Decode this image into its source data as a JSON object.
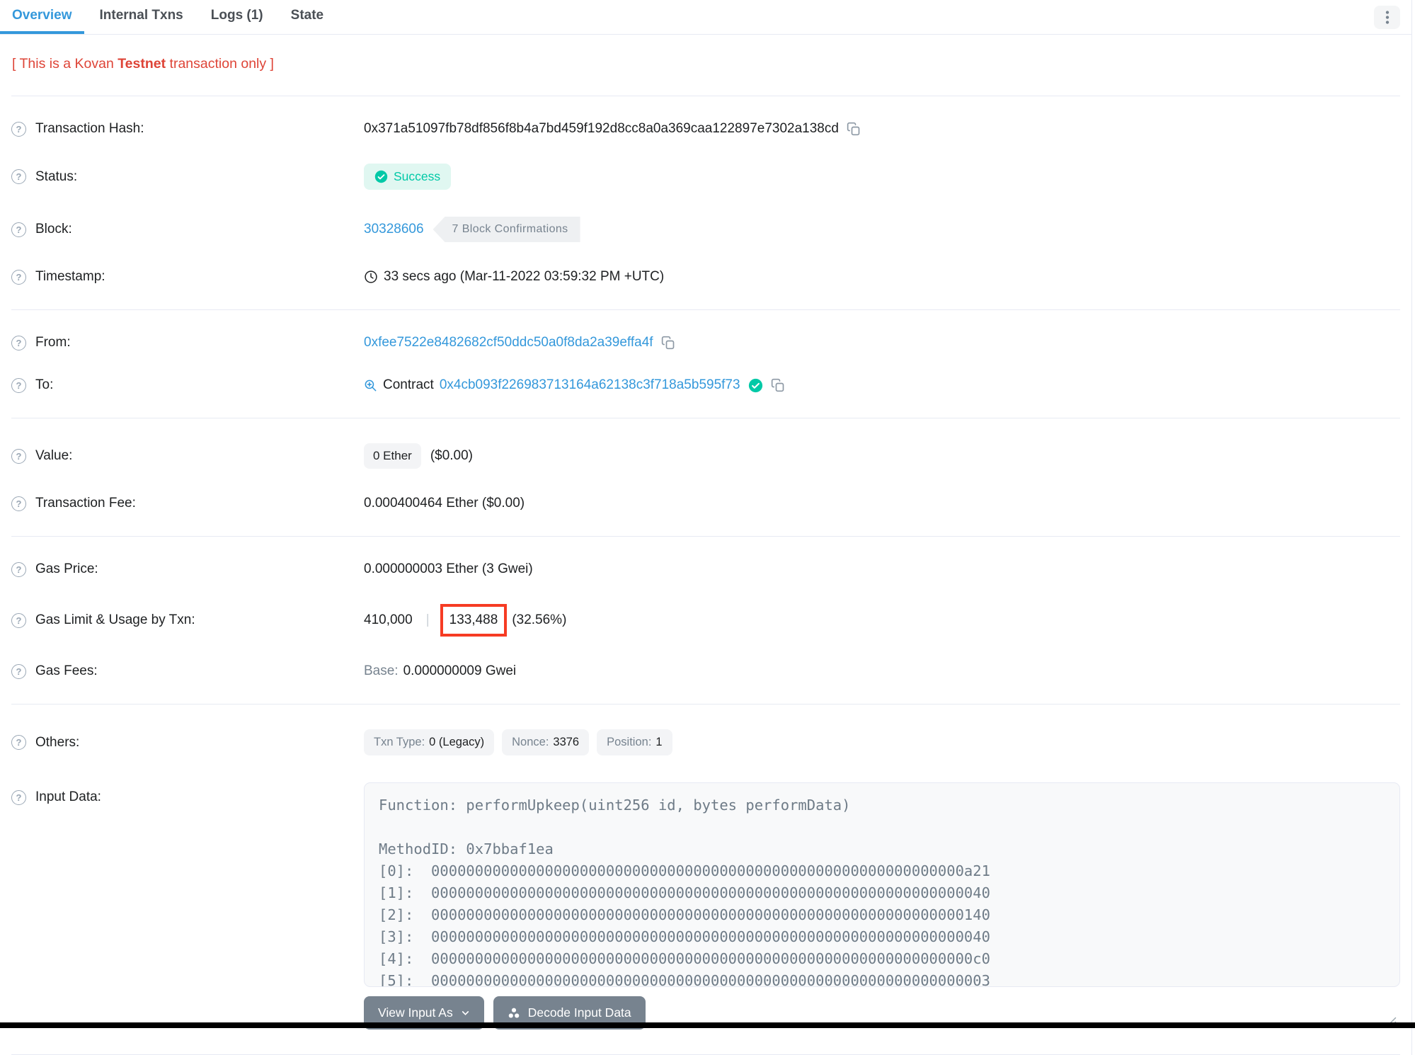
{
  "tabs": [
    {
      "label": "Overview",
      "active": true
    },
    {
      "label": "Internal Txns",
      "active": false
    },
    {
      "label": "Logs (1)",
      "active": false
    },
    {
      "label": "State",
      "active": false
    }
  ],
  "notice": {
    "prefix": "[ This is a Kovan ",
    "bold": "Testnet",
    "suffix": " transaction only ]"
  },
  "rows": {
    "transaction_hash": {
      "label": "Transaction Hash:",
      "value": "0x371a51097fb78df856f8b4a7bd459f192d8cc8a0a369caa122897e7302a138cd"
    },
    "status": {
      "label": "Status:",
      "value": "Success"
    },
    "block": {
      "label": "Block:",
      "number": "30328606",
      "confirmations": "7 Block Confirmations"
    },
    "timestamp": {
      "label": "Timestamp:",
      "value": "33 secs ago (Mar-11-2022 03:59:32 PM +UTC)"
    },
    "from": {
      "label": "From:",
      "address": "0xfee7522e8482682cf50ddc50a0f8da2a39effa4f"
    },
    "to": {
      "label": "To:",
      "contract_word": "Contract",
      "address": "0x4cb093f226983713164a62138c3f718a5b595f73"
    },
    "value": {
      "label": "Value:",
      "badge": "0 Ether",
      "usd": "($0.00)"
    },
    "transaction_fee": {
      "label": "Transaction Fee:",
      "value": "0.000400464 Ether ($0.00)"
    },
    "gas_price": {
      "label": "Gas Price:",
      "value": "0.000000003 Ether (3 Gwei)"
    },
    "gas_limit": {
      "label": "Gas Limit & Usage by Txn:",
      "limit": "410,000",
      "separator": "|",
      "used": "133,488",
      "percent": "(32.56%)"
    },
    "gas_fees": {
      "label": "Gas Fees:",
      "base_label": "Base:",
      "base_value": "0.000000009 Gwei"
    },
    "others": {
      "label": "Others:",
      "badges": [
        {
          "k": "Txn Type:",
          "v": "0 (Legacy)"
        },
        {
          "k": "Nonce:",
          "v": "3376"
        },
        {
          "k": "Position:",
          "v": "1"
        }
      ]
    },
    "input_data": {
      "label": "Input Data:",
      "text": "Function: performUpkeep(uint256 id, bytes performData)\n\nMethodID: 0x7bbaf1ea\n[0]:  0000000000000000000000000000000000000000000000000000000000000a21\n[1]:  0000000000000000000000000000000000000000000000000000000000000040\n[2]:  0000000000000000000000000000000000000000000000000000000000000140\n[3]:  0000000000000000000000000000000000000000000000000000000000000040\n[4]:  00000000000000000000000000000000000000000000000000000000000000c0\n[5]:  0000000000000000000000000000000000000000000000000000000000000003"
    }
  },
  "buttons": {
    "view_input_as": "View Input As",
    "decode_input_data": "Decode Input Data"
  },
  "icons": {
    "help": "question-circle",
    "copy": "copy",
    "clock": "clock",
    "zoom_contract": "zoom-in-magnifier",
    "verified": "check-circle",
    "success": "check-circle",
    "kebab": "vertical-ellipsis",
    "caret": "chevron-down",
    "decode": "three-circles"
  },
  "colors": {
    "accent_blue": "#3498db",
    "success_green": "#00c9a7",
    "success_bg": "#e0f7f1",
    "danger_red": "#de4437",
    "highlight_box_red": "#f63b23",
    "secondary_gray": "#77838f",
    "border_gray": "#e7eaf3",
    "button_gray": "#77838f"
  }
}
